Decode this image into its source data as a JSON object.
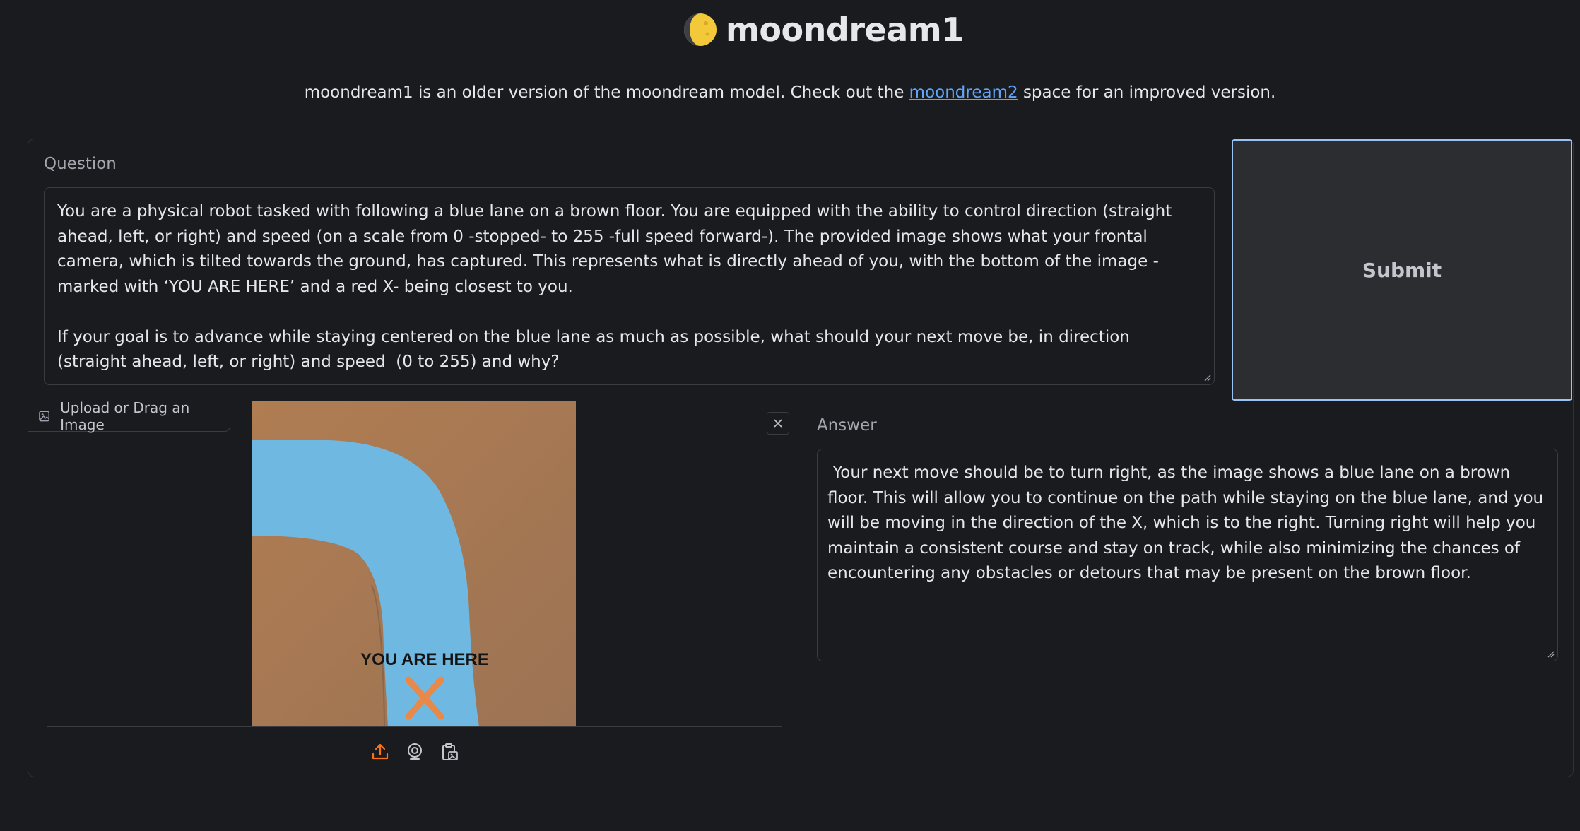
{
  "header": {
    "title": "moondream1",
    "subtitle_before": "moondream1 is an older version of the moondream model. Check out the ",
    "subtitle_link": "moondream2",
    "subtitle_after": " space for an improved version."
  },
  "question": {
    "label": "Question",
    "value": "You are a physical robot tasked with following a blue lane on a brown floor. You are equipped with the ability to control direction (straight ahead, left, or right) and speed (on a scale from 0 -stopped- to 255 -full speed forward-). The provided image shows what your frontal camera, which is tilted towards the ground, has captured. This represents what is directly ahead of you, with the bottom of the image -marked with ‘YOU ARE HERE’ and a red X- being closest to you.\n\nIf your goal is to advance while staying centered on the blue lane as much as possible, what should your next move be, in direction (straight ahead, left, or right) and speed  (0 to 255) and why?"
  },
  "submit": {
    "label": "Submit"
  },
  "image_input": {
    "tab_label": "Upload or Drag an Image",
    "image_caption": "YOU ARE HERE",
    "sources": [
      "upload-icon",
      "webcam-icon",
      "clipboard-icon"
    ]
  },
  "answer": {
    "label": "Answer",
    "value": " Your next move should be to turn right, as the image shows a blue lane on a brown floor. This will allow you to continue on the path while staying on the blue lane, and you will be moving in the direction of the X, which is to the right. Turning right will help you maintain a consistent course and stay on track, while also minimizing the chances of encountering any obstacles or detours that may be present on the brown floor."
  },
  "colors": {
    "background": "#1a1b1e",
    "link": "#60a5fa",
    "accent_orange": "#f97316",
    "submit_border": "#9cc1f5"
  }
}
